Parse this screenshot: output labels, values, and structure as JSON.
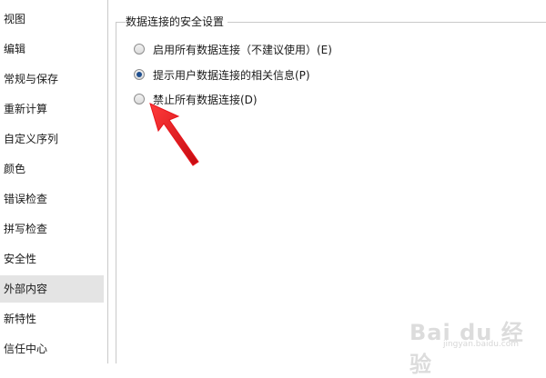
{
  "sidebar": {
    "items": [
      {
        "label": "视图"
      },
      {
        "label": "编辑"
      },
      {
        "label": "常规与保存"
      },
      {
        "label": "重新计算"
      },
      {
        "label": "自定义序列"
      },
      {
        "label": "颜色"
      },
      {
        "label": "错误检查"
      },
      {
        "label": "拼写检查"
      },
      {
        "label": "安全性"
      },
      {
        "label": "外部内容",
        "selected": true
      },
      {
        "label": "新特性"
      },
      {
        "label": "信任中心"
      }
    ]
  },
  "content": {
    "group_title": "数据连接的安全设置",
    "options": [
      {
        "label": "启用所有数据连接（不建议使用）(E)",
        "checked": false
      },
      {
        "label": "提示用户数据连接的相关信息(P)",
        "checked": true
      },
      {
        "label": "禁止所有数据连接(D)",
        "checked": false
      }
    ]
  },
  "annotation": {
    "arrow_color": "#e8141c"
  },
  "watermark": {
    "brand": "Bai du 经验",
    "url": "jingyan.baidu.com"
  }
}
